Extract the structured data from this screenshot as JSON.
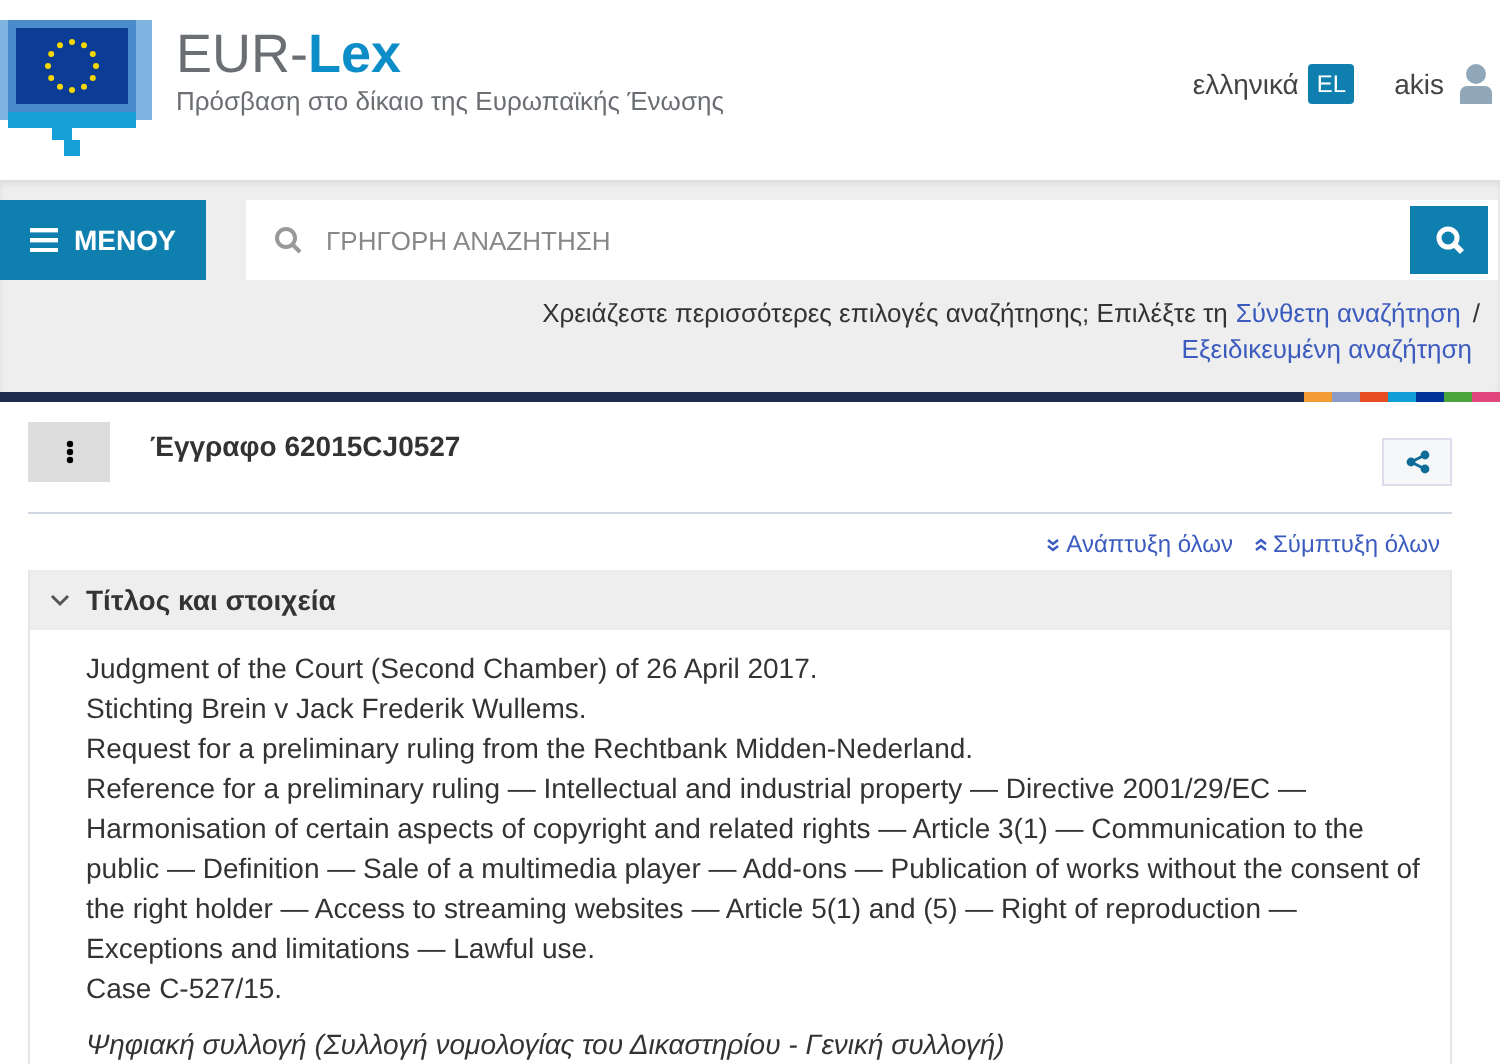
{
  "logo": {
    "title_light": "EUR-",
    "title_bold": "Lex",
    "subtitle": "Πρόσβαση στο δίκαιο της Ευρωπαϊκής Ένωσης"
  },
  "header": {
    "language": "ελληνικά",
    "language_code": "EL",
    "user": "akis"
  },
  "menu_button": "ΜΕΝΟΥ",
  "search": {
    "placeholder": "ΓΡΗΓΟΡΗ ΑΝΑΖΗΤΗΣΗ"
  },
  "search_hint": {
    "text": "Χρειάζεστε περισσότερες επιλογές αναζήτησης; Επιλέξτε τη",
    "link_1": "Σύνθετη αναζήτηση",
    "separator": "/",
    "link_2": "Εξειδικευμένη αναζήτηση"
  },
  "document": {
    "title": "Έγγραφο 62015CJ0527",
    "expand_all": "Ανάπτυξη όλων",
    "collapse_all": "Σύμπτυξη όλων"
  },
  "section": {
    "title": "Τίτλος και στοιχεία",
    "expanded": true,
    "lines": [
      "Judgment of the Court (Second Chamber) of 26 April 2017.",
      "Stichting Brein v Jack Frederik Wullems.",
      "Request for a preliminary ruling from the Rechtbank Midden-Nederland.",
      "Reference for a preliminary ruling — Intellectual and industrial property — Directive 2001/29/EC — Harmonisation of certain aspects of copyright and related rights — Article 3(1) — Communication to the public — Definition — Sale of a multimedia player — Add-ons — Publication of works without the consent of the right holder — Access to streaming websites — Article 5(1) and (5) — Right of reproduction — Exceptions and limitations — Lawful use.",
      "Case C-527/15."
    ],
    "collection": "Ψηφιακή συλλογή (Συλλογή νομολογίας του Δικαστηρίου - Γενική συλλογή)"
  }
}
